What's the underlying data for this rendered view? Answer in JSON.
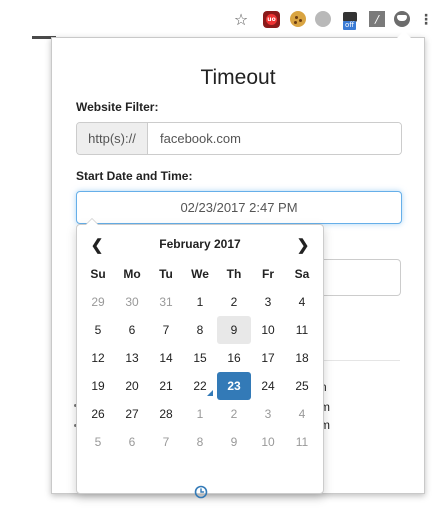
{
  "toolbar": {
    "icons": [
      "star-icon",
      "ublock-icon",
      "cookie-icon",
      "grey-extension-icon",
      "mail-extension-icon",
      "script-extension-icon",
      "timeout-extension-icon",
      "kebab-menu-icon"
    ],
    "mail_badge": "off",
    "star_glyph": "☆",
    "slash_glyph": "/",
    "kebab_glyph": "⋮",
    "ublock_text": "uo"
  },
  "popup": {
    "title": "Timeout",
    "website_filter_label": "Website Filter:",
    "protocol_addon": "http(s)://",
    "website_value": "facebook.com",
    "start_label": "Start Date and Time:",
    "start_value": "02/23/2017 2:47 PM",
    "peek_texts": [
      "n",
      "m",
      "m"
    ]
  },
  "calendar": {
    "prev_glyph": "❮",
    "next_glyph": "❯",
    "month_label": "February 2017",
    "weekdays": [
      "Su",
      "Mo",
      "Tu",
      "We",
      "Th",
      "Fr",
      "Sa"
    ],
    "weeks": [
      [
        "29",
        "30",
        "31",
        "1",
        "2",
        "3",
        "4"
      ],
      [
        "5",
        "6",
        "7",
        "8",
        "9",
        "10",
        "11"
      ],
      [
        "12",
        "13",
        "14",
        "15",
        "16",
        "17",
        "18"
      ],
      [
        "19",
        "20",
        "21",
        "22",
        "23",
        "24",
        "25"
      ],
      [
        "26",
        "27",
        "28",
        "1",
        "2",
        "3",
        "4"
      ],
      [
        "5",
        "6",
        "7",
        "8",
        "9",
        "10",
        "11"
      ]
    ],
    "selected_day": "23",
    "today_day": "22",
    "highlighted_day": "9",
    "accent_color": "#337ab7",
    "clock_icon": "clock-icon"
  }
}
